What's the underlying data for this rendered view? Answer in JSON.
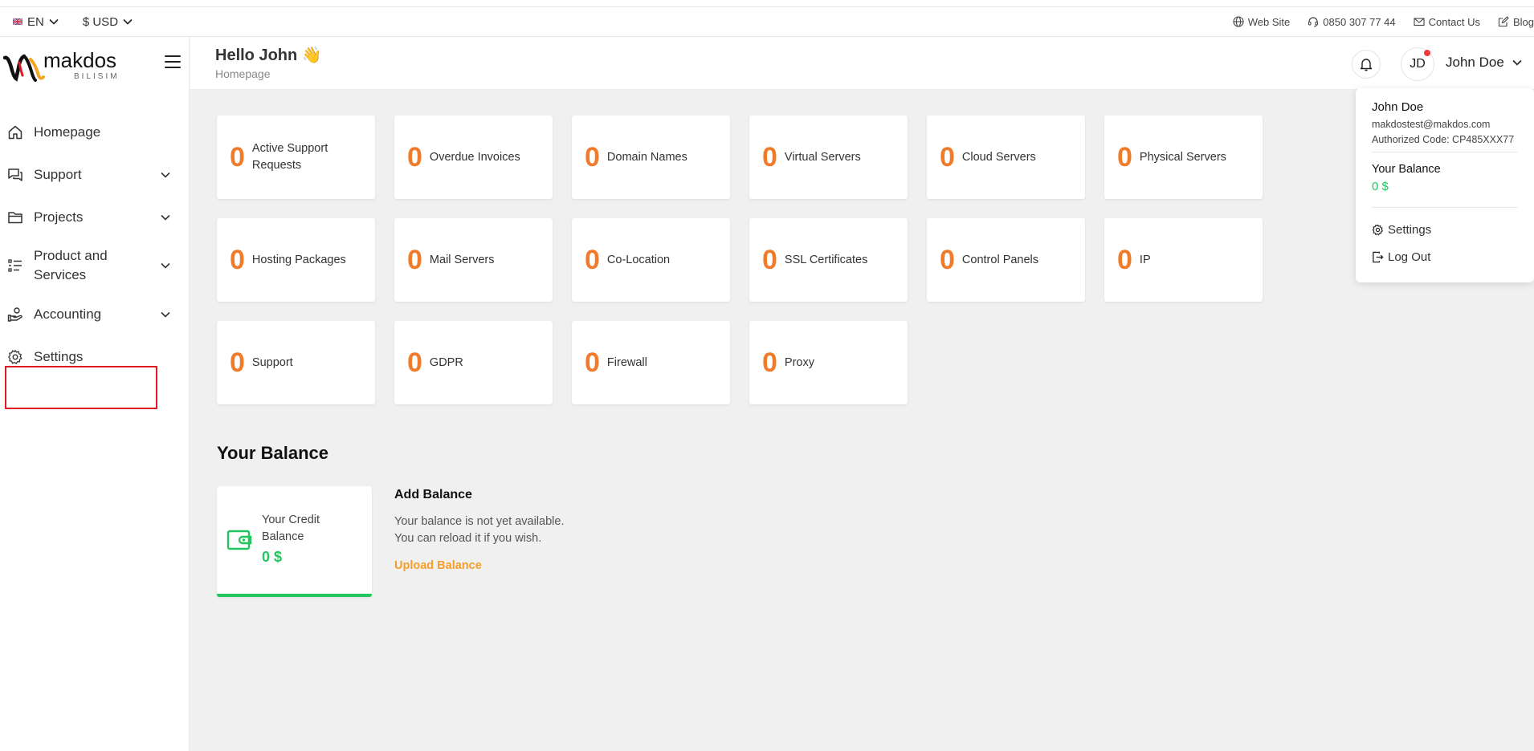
{
  "topbar": {
    "language": "EN",
    "currency": "$ USD",
    "links": {
      "website": "Web Site",
      "phone": "0850 307 77 44",
      "contact": "Contact Us",
      "blog": "Blog"
    }
  },
  "brand": {
    "name": "makdos",
    "sub": "BILISIM",
    "colors": {
      "accent": "#f07c2b",
      "success": "#22c55e",
      "highlight": "#e01b24"
    }
  },
  "sidebar": {
    "items": [
      {
        "label": "Homepage",
        "icon": "home-icon"
      },
      {
        "label": "Support",
        "icon": "chat-icon"
      },
      {
        "label": "Projects",
        "icon": "folder-icon"
      },
      {
        "label": "Product and Services",
        "icon": "list-icon"
      },
      {
        "label": "Accounting",
        "icon": "hand-coin-icon"
      },
      {
        "label": "Settings",
        "icon": "gear-icon"
      }
    ]
  },
  "header": {
    "greeting": "Hello John 👋",
    "breadcrumb": "Homepage",
    "avatar_initials": "JD",
    "user_name": "John Doe"
  },
  "stats": [
    {
      "value": "0",
      "label": "Active Support Requests"
    },
    {
      "value": "0",
      "label": "Overdue Invoices"
    },
    {
      "value": "0",
      "label": "Domain Names"
    },
    {
      "value": "0",
      "label": "Virtual Servers"
    },
    {
      "value": "0",
      "label": "Cloud Servers"
    },
    {
      "value": "0",
      "label": "Physical Servers"
    },
    {
      "value": "0",
      "label": "Hosting Packages"
    },
    {
      "value": "0",
      "label": "Mail Servers"
    },
    {
      "value": "0",
      "label": "Co-Location"
    },
    {
      "value": "0",
      "label": "SSL Certificates"
    },
    {
      "value": "0",
      "label": "Control Panels"
    },
    {
      "value": "0",
      "label": "IP"
    },
    {
      "value": "0",
      "label": "Support"
    },
    {
      "value": "0",
      "label": "GDPR"
    },
    {
      "value": "0",
      "label": "Firewall"
    },
    {
      "value": "0",
      "label": "Proxy"
    }
  ],
  "balance": {
    "title": "Your Balance",
    "credit_label": "Your Credit Balance",
    "credit_value": "0 $",
    "add_title": "Add Balance",
    "add_line1": "Your balance is not yet available.",
    "add_line2": "You can reload it if you wish.",
    "upload_label": "Upload Balance"
  },
  "dropdown": {
    "name": "John Doe",
    "email": "makdostest@makdos.com",
    "code": "Authorized Code: CP485XXX77",
    "balance_label": "Your Balance",
    "balance_value": "0 $",
    "settings_label": "Settings",
    "logout_label": "Log Out"
  }
}
